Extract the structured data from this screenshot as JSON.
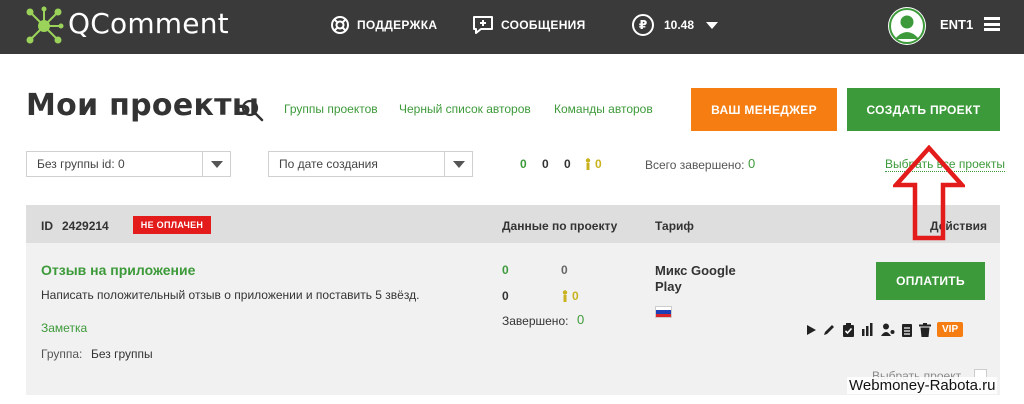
{
  "header": {
    "logo_text": "QComment",
    "nav": {
      "support": "ПОДДЕРЖКА",
      "messages": "СООБЩЕНИЯ"
    },
    "balance": {
      "currency_symbol": "₽",
      "amount": "10.48"
    },
    "user": {
      "name": "ENT1"
    }
  },
  "page": {
    "title": "Мои проекты",
    "links": [
      "Группы проектов",
      "Черный список авторов",
      "Команды авторов"
    ],
    "manager_button": "ВАШ МЕНЕДЖЕР",
    "create_button": "СОЗДАТЬ ПРОЕКТ"
  },
  "filters": {
    "group_select": "Без группы id: 0",
    "sort_select": "По дате создания",
    "counts": {
      "green": "0",
      "dark": "0",
      "total": "0",
      "worker": "0"
    },
    "total_done_label": "Всего завершено:",
    "total_done_value": "0",
    "select_all": "Выбрать все проекты"
  },
  "project": {
    "id_label": "ID",
    "id": "2429214",
    "status_badge": "НЕ ОПЛАЧЕН",
    "col_data": "Данные по проекту",
    "col_tariff": "Тариф",
    "col_actions": "Действия",
    "title": "Отзыв на приложение",
    "description": "Написать положительный отзыв о приложении и поставить 5 звёзд.",
    "note_link": "Заметка",
    "group_label": "Группа:",
    "group_value": "Без группы",
    "stats": {
      "green": "0",
      "grey": "0",
      "dark": "0",
      "worker": "0"
    },
    "done_label": "Завершено:",
    "done_value": "0",
    "tariff": "Микс Google Play",
    "pay_button": "ОПЛАТИТЬ",
    "vip_badge": "VIP",
    "choose_label": "Выбрать проект"
  },
  "watermark": "Webmoney-Rabota.ru",
  "colors": {
    "accent_green": "#3d9a3a",
    "accent_orange": "#f57d12",
    "badge_red": "#e31b1b",
    "topbar": "#3a3a3a"
  }
}
